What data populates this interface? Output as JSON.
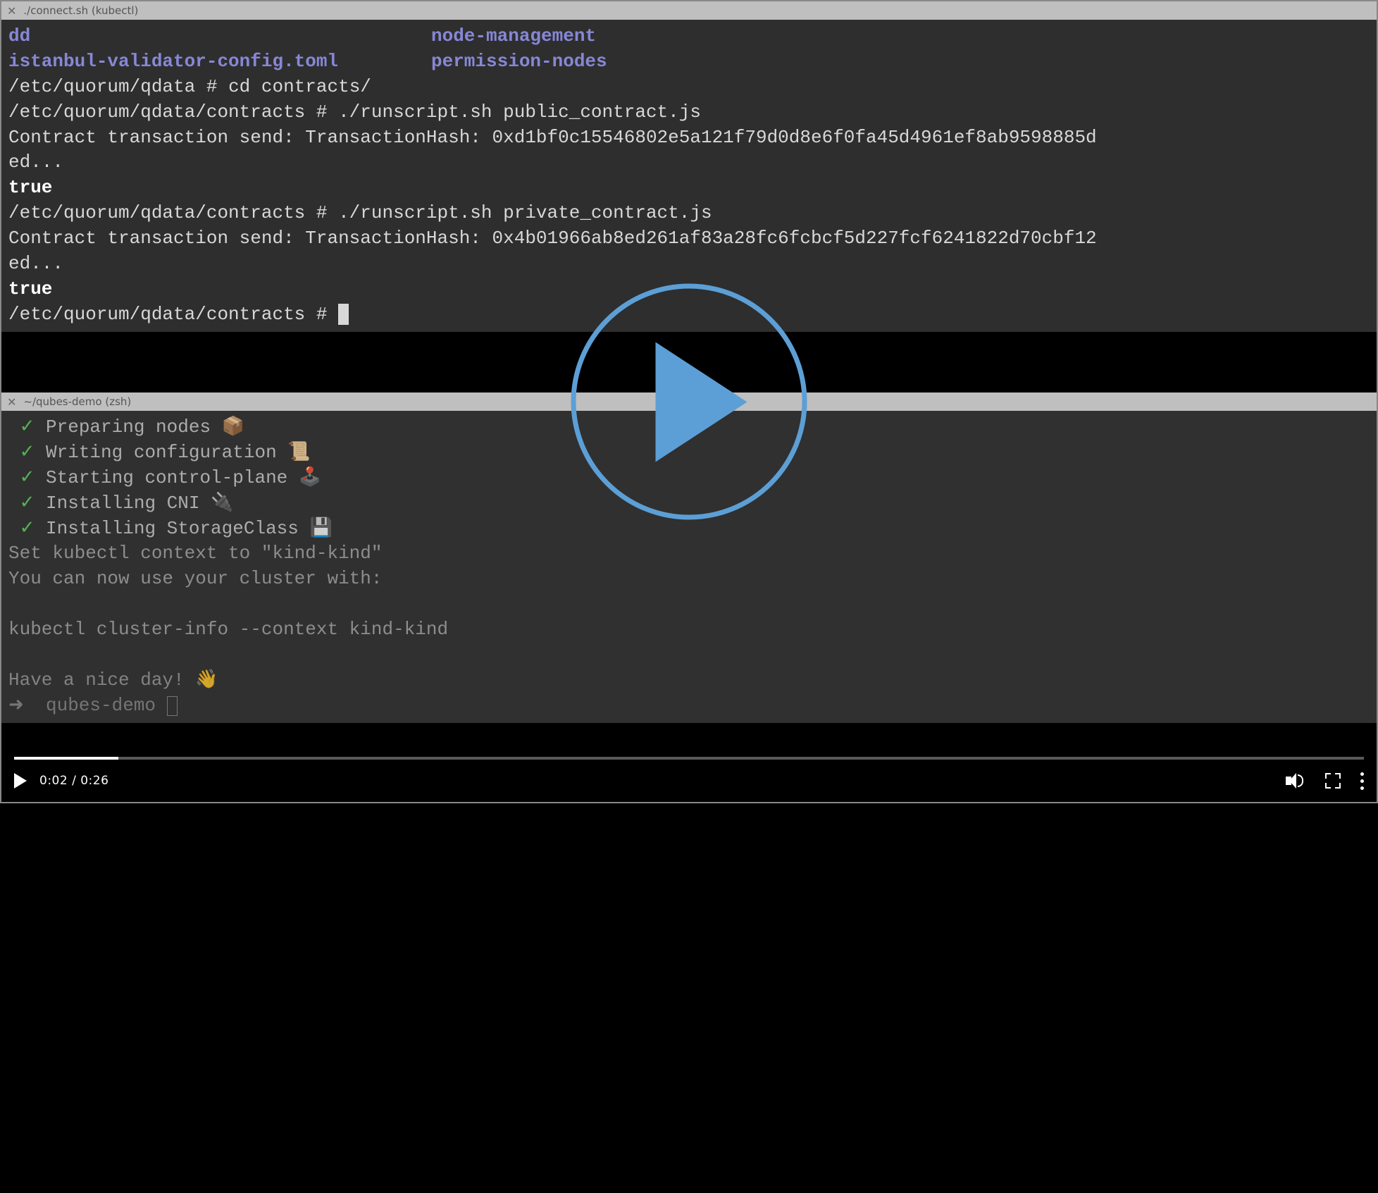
{
  "upper_terminal": {
    "titlebar": "./connect.sh (kubectl)",
    "dir_listing": [
      {
        "col1": "dd",
        "col2": "node-management"
      },
      {
        "col1": "istanbul-validator-config.toml",
        "col2": "permission-nodes"
      }
    ],
    "lines": {
      "l1_prompt": "/etc/quorum/qdata # ",
      "l1_cmd": "cd contracts/",
      "l2_prompt": "/etc/quorum/qdata/contracts # ",
      "l2_cmd": "./runscript.sh public_contract.js",
      "l3": "Contract transaction send: TransactionHash: 0xd1bf0c15546802e5a121f79d0d8e6f0fa45d4961ef8ab9598885d",
      "l4": "ed...",
      "l5_true": "true",
      "l6_prompt": "/etc/quorum/qdata/contracts # ",
      "l6_cmd": "./runscript.sh private_contract.js",
      "l7": "Contract transaction send: TransactionHash: 0x4b01966ab8ed261af83a28fc6fcbcf5d227fcf6241822d70cbf12",
      "l8": "ed...",
      "l9_true": "true",
      "l10_prompt": "/etc/quorum/qdata/contracts # "
    }
  },
  "lower_terminal": {
    "titlebar": "~/qubes-demo (zsh)",
    "steps": [
      {
        "text": "Preparing nodes ",
        "emoji": "📦"
      },
      {
        "text": "Writing configuration ",
        "emoji": "📜"
      },
      {
        "text": "Starting control-plane ",
        "emoji": "🕹️"
      },
      {
        "text": "Installing CNI ",
        "emoji": "🔌"
      },
      {
        "text": "Installing StorageClass ",
        "emoji": "💾"
      }
    ],
    "post": {
      "p1": "Set kubectl context to \"kind-kind\"",
      "p2": "You can now use your cluster with:",
      "p3": "kubectl cluster-info --context kind-kind",
      "p4": "Have a nice day! 👋",
      "p5": "➜  qubes-demo "
    },
    "checkmark": "✓"
  },
  "video": {
    "current_time": "0:02",
    "duration": "0:26",
    "time_sep": " / "
  }
}
